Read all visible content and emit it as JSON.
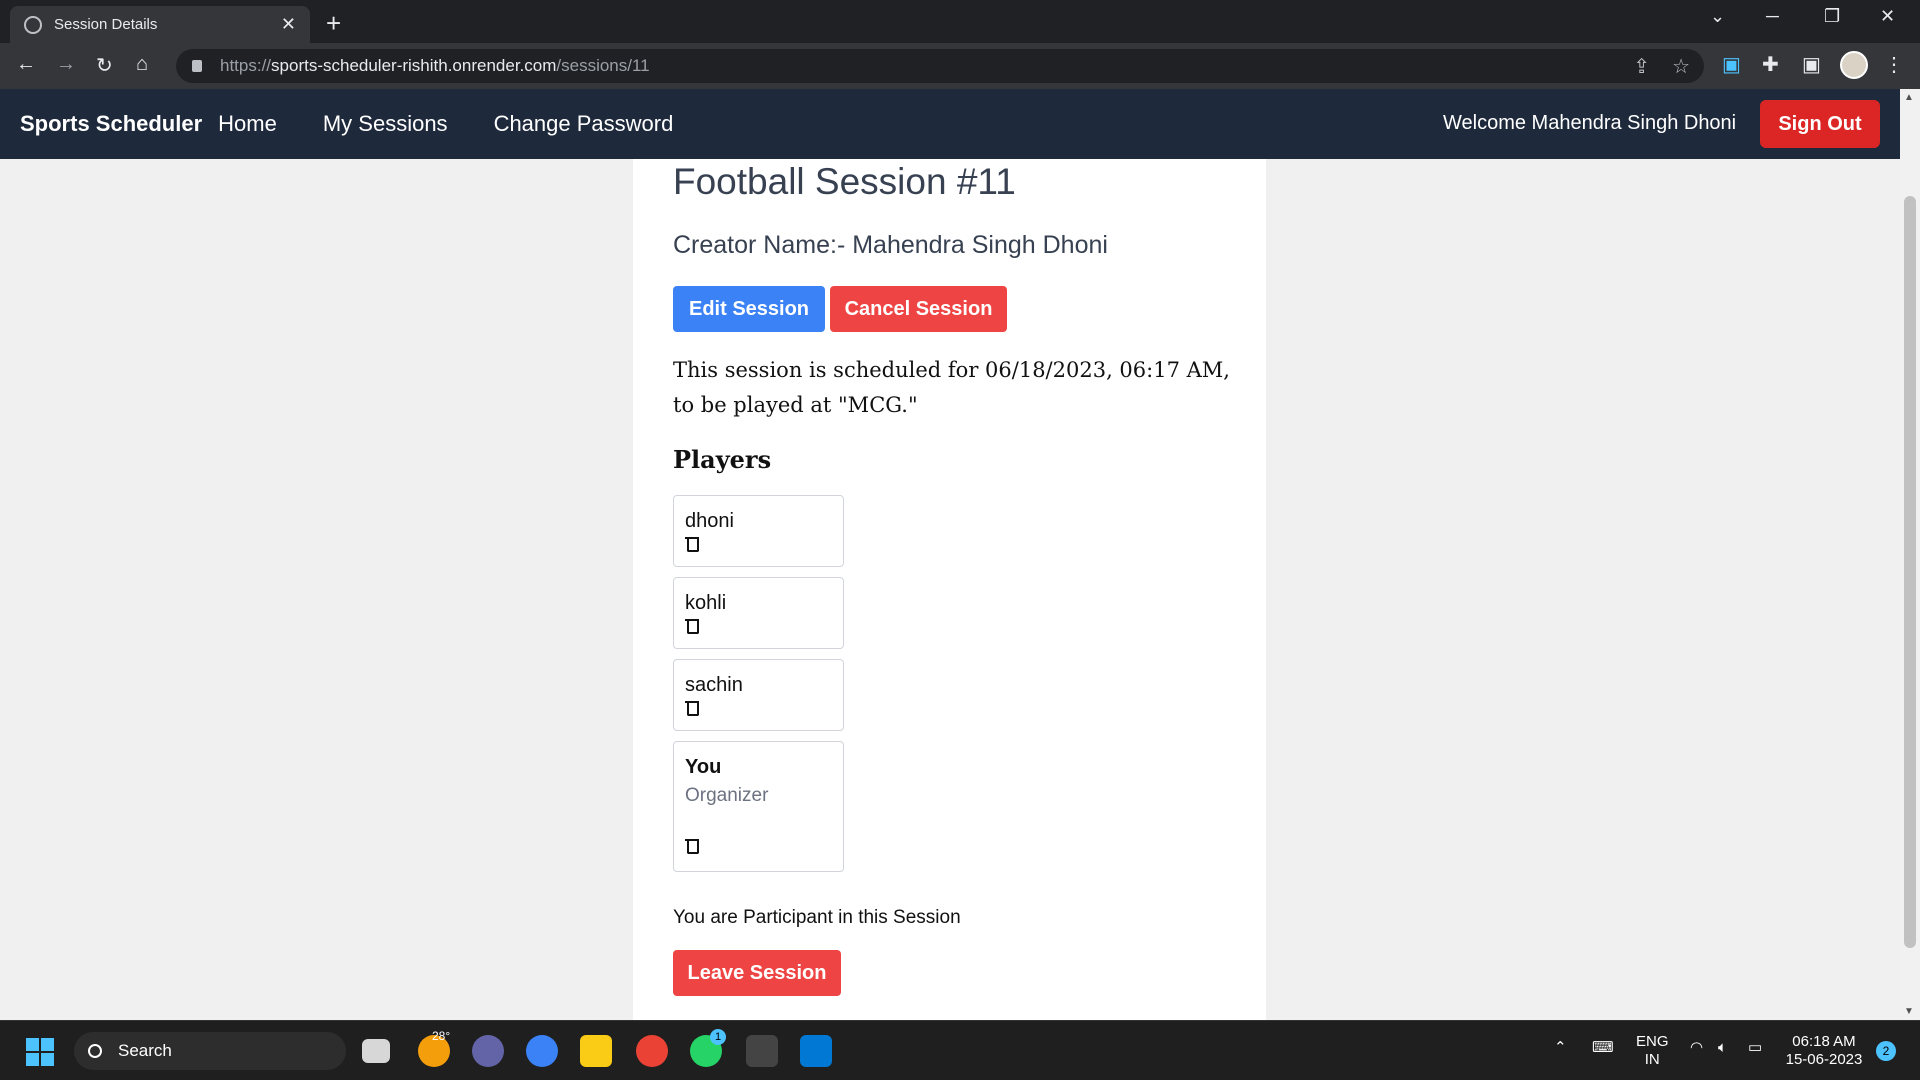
{
  "browser": {
    "tab_title": "Session Details",
    "close_glyph": "✕",
    "new_tab_glyph": "+",
    "url_scheme": "https://",
    "url_host": "sports-scheduler-rishith.onrender.com",
    "url_path": "/sessions/11",
    "minimize_glyph": "─",
    "restore_glyph": "❐",
    "window_close_glyph": "✕",
    "tab_list_glyph": "⌄",
    "back_glyph": "←",
    "forward_glyph": "→",
    "reload_glyph": "↻",
    "home_glyph": "⌂",
    "share_glyph": "⇪",
    "star_glyph": "☆",
    "extensions_glyph": "✚",
    "sidepanel_glyph": "▣",
    "menu_glyph": "⋮"
  },
  "navbar": {
    "brand": "Sports Scheduler",
    "links": [
      "Home",
      "My Sessions",
      "Change Password"
    ],
    "welcome": "Welcome Mahendra Singh Dhoni",
    "sign_out": "Sign Out"
  },
  "session": {
    "title": "Football Session #11",
    "creator": "Creator Name:- Mahendra Singh Dhoni",
    "edit_label": "Edit Session",
    "cancel_label": "Cancel Session",
    "schedule_text": "This session is scheduled for 06/18/2023, 06:17 AM, to be played at \"MCG.\"",
    "players_heading": "Players",
    "players": [
      {
        "name": "dhoni"
      },
      {
        "name": "kohli"
      },
      {
        "name": "sachin"
      },
      {
        "name": "You",
        "role": "Organizer"
      }
    ],
    "participant_text": "You are Participant in this Session",
    "leave_label": "Leave Session"
  },
  "taskbar": {
    "search_placeholder": "Search",
    "weather_temp": "28°",
    "whatsapp_badge": "1",
    "lang_top": "ENG",
    "lang_bottom": "IN",
    "time": "06:18 AM",
    "date": "15-06-2023",
    "notification_count": "2",
    "tray_chevron": "⌃"
  },
  "colors": {
    "navbar_bg": "#1e293b",
    "primary_blue": "#3b82f6",
    "danger_red": "#ef4444",
    "sign_out_red": "#dc2626"
  }
}
